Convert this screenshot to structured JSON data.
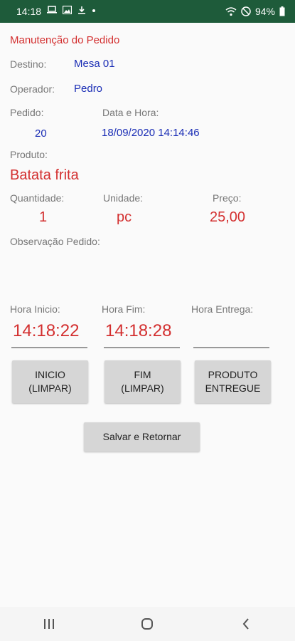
{
  "status": {
    "time": "14:18",
    "battery": "94%",
    "icons_left": [
      "laptop-icon",
      "image-icon",
      "download-icon",
      "dot-icon"
    ],
    "icons_right": [
      "wifi-icon",
      "dnd-icon",
      "battery-icon"
    ]
  },
  "page": {
    "title": "Manutenção do Pedido"
  },
  "fields": {
    "destino_label": "Destino:",
    "destino": "Mesa 01",
    "operador_label": "Operador:",
    "operador": "Pedro",
    "pedido_label": "Pedido:",
    "pedido": "20",
    "datahora_label": "Data e Hora:",
    "datahora": "18/09/2020 14:14:46",
    "produto_label": "Produto:",
    "produto": "Batata frita",
    "quantidade_label": "Quantidade:",
    "quantidade": "1",
    "unidade_label": "Unidade:",
    "unidade": "pc",
    "preco_label": "Preço:",
    "preco": "25,00",
    "observacao_label": "Observação Pedido:"
  },
  "times": {
    "inicio_label": "Hora Inicio:",
    "inicio": "14:18:22",
    "fim_label": "Hora Fim:",
    "fim": "14:18:28",
    "entrega_label": "Hora Entrega:",
    "entrega": ""
  },
  "buttons": {
    "inicio_line1": "INICIO",
    "inicio_line2": "(LIMPAR)",
    "fim_line1": "FIM",
    "fim_line2": "(LIMPAR)",
    "entregue_line1": "PRODUTO",
    "entregue_line2": "ENTREGUE",
    "salvar": "Salvar e Retornar"
  },
  "colors": {
    "statusbar": "#1e5b3a",
    "accent_red": "#d32f2f",
    "value_blue": "#1a2db5"
  }
}
